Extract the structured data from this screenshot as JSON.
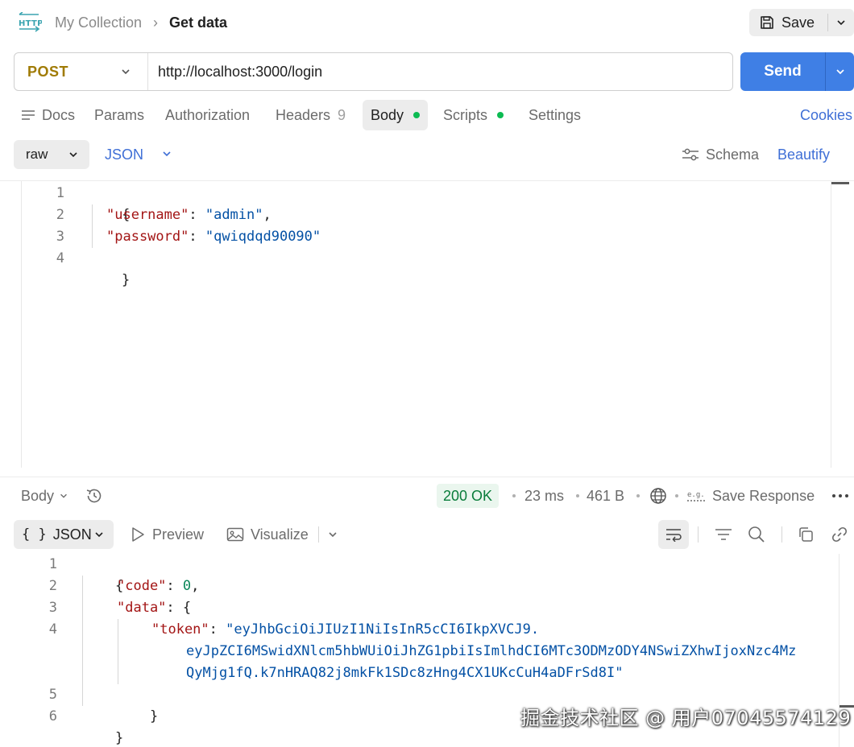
{
  "breadcrumb": {
    "collection": "My Collection",
    "separator": "›",
    "request": "Get data"
  },
  "toolbar": {
    "save_label": "Save",
    "send_label": "Send"
  },
  "request": {
    "method": "POST",
    "url": "http://localhost:3000/login"
  },
  "tabs": {
    "docs": "Docs",
    "params": "Params",
    "authorization": "Authorization",
    "headers": "Headers",
    "headers_count": "9",
    "body": "Body",
    "scripts": "Scripts",
    "settings": "Settings",
    "cookies": "Cookies",
    "active": "Body"
  },
  "body_options": {
    "mode": "raw",
    "language": "JSON",
    "schema": "Schema",
    "beautify": "Beautify"
  },
  "request_body": {
    "line_numbers": [
      "1",
      "2",
      "3",
      "4"
    ],
    "open_brace": "{",
    "close_brace": "}",
    "username_key": "\"username\"",
    "username_value": "\"admin\"",
    "password_key": "\"password\"",
    "password_value": "\"qwiqdqd90090\"",
    "colon": ": ",
    "comma": ","
  },
  "response": {
    "body_tab": "Body",
    "status": "200 OK",
    "time": "23 ms",
    "size": "461 B",
    "save_response": "Save Response",
    "format": "JSON",
    "preview": "Preview",
    "visualize": "Visualize",
    "line_numbers": [
      "1",
      "2",
      "3",
      "4",
      "5",
      "6"
    ],
    "open_brace": "{",
    "close_brace": "}",
    "code_key": "\"code\"",
    "code_value": "0",
    "data_key": "\"data\"",
    "token_key": "\"token\"",
    "token_value_line1": "\"eyJhbGciOiJIUzI1NiIsInR5cCI6IkpXVCJ9.",
    "token_value_line2": "eyJpZCI6MSwidXNlcm5hbWUiOiJhZG1pbiIsImlhdCI6MTc3ODMzODY4NSwiZXhwIjoxNzc4Mz",
    "token_value_line3": "QyMjg1fQ.k7nHRAQ82j8mkFk1SDc8zHng4CX1UKcCuH4aDFrSd8I\"",
    "colon": ": ",
    "comma": ","
  },
  "watermark": "掘金技术社区 @ 用户07045574129",
  "colors": {
    "accent": "#3f7fe5",
    "method": "#a07b05",
    "json_key": "#a31515",
    "json_string": "#0451a5",
    "json_number": "#098658",
    "status_ok": "#0a7d3b",
    "dot_active": "#0cbb52"
  }
}
